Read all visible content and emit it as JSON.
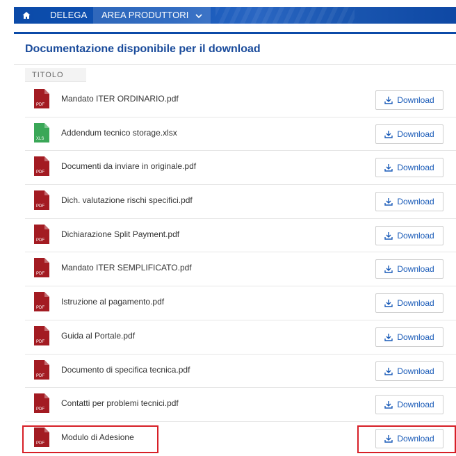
{
  "nav": {
    "home_icon": "home-icon",
    "items": [
      {
        "label": "DELEGA"
      },
      {
        "label": "AREA PRODUTTORI",
        "dropdown_icon": "chevron-down-icon"
      }
    ]
  },
  "panel": {
    "title": "Documentazione disponibile per il download",
    "column_header": "TITOLO",
    "download_label": "Download",
    "files": [
      {
        "name": "Mandato ITER ORDINARIO.pdf",
        "type": "PDF"
      },
      {
        "name": "Addendum tecnico storage.xlsx",
        "type": "XLS"
      },
      {
        "name": "Documenti da inviare in originale.pdf",
        "type": "PDF"
      },
      {
        "name": "Dich. valutazione rischi specifici.pdf",
        "type": "PDF"
      },
      {
        "name": "Dichiarazione Split Payment.pdf",
        "type": "PDF"
      },
      {
        "name": "Mandato ITER SEMPLIFICATO.pdf",
        "type": "PDF"
      },
      {
        "name": "Istruzione al pagamento.pdf",
        "type": "PDF"
      },
      {
        "name": "Guida al Portale.pdf",
        "type": "PDF"
      },
      {
        "name": "Documento di specifica tecnica.pdf",
        "type": "PDF"
      },
      {
        "name": "Contatti per problemi tecnici.pdf",
        "type": "PDF"
      },
      {
        "name": "Modulo di Adesione",
        "type": "PDF"
      }
    ]
  },
  "colors": {
    "nav_blue": "#0b4aa8",
    "title_blue": "#1a4b9b",
    "pdf_red": "#a31b22",
    "xls_green": "#3aa757",
    "highlight_red": "#d71f27"
  }
}
